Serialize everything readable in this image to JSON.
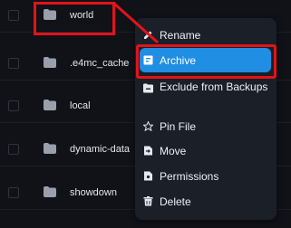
{
  "files": [
    {
      "name": "world"
    },
    {
      "name": ".e4mc_cache"
    },
    {
      "name": "local"
    },
    {
      "name": "dynamic-data"
    },
    {
      "name": "showdown"
    }
  ],
  "context_menu": {
    "items": [
      {
        "label": "Rename",
        "icon": "rename-icon"
      },
      {
        "label": "Archive",
        "icon": "archive-icon",
        "active": true
      },
      {
        "label": "Exclude from Backups",
        "icon": "exclude-icon"
      },
      {
        "label": "Pin File",
        "icon": "star-icon"
      },
      {
        "label": "Move",
        "icon": "move-icon"
      },
      {
        "label": "Permissions",
        "icon": "permissions-icon"
      },
      {
        "label": "Delete",
        "icon": "trash-icon"
      }
    ]
  },
  "colors": {
    "background": "#101218",
    "menu_background": "#1b1f28",
    "accent": "#1f8ee3",
    "annotation": "#e0141a"
  }
}
